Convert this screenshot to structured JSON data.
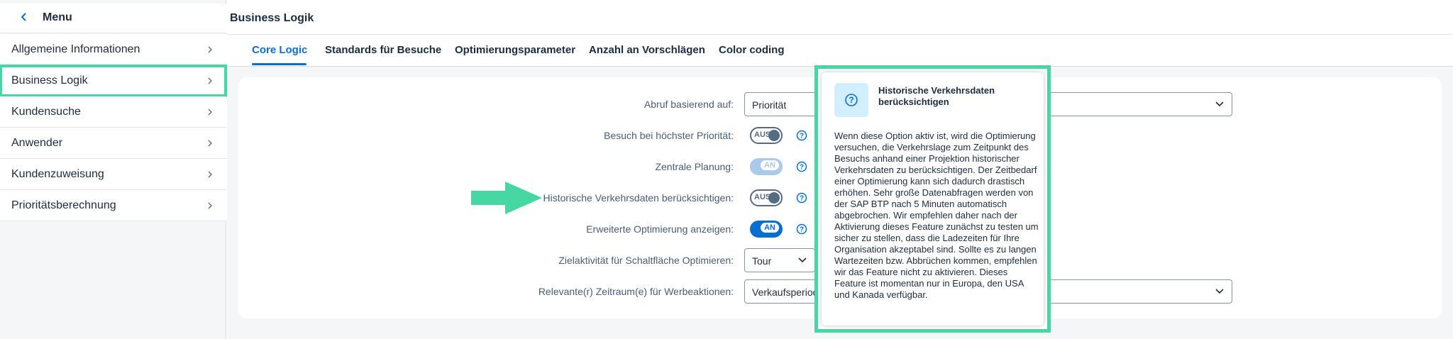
{
  "sidebar": {
    "title": "Menu",
    "items": [
      {
        "label": "Allgemeine Informationen"
      },
      {
        "label": "Business Logik"
      },
      {
        "label": "Kundensuche"
      },
      {
        "label": "Anwender"
      },
      {
        "label": "Kundenzuweisung"
      },
      {
        "label": "Prioritätsberechnung"
      }
    ],
    "selected": "Business Logik"
  },
  "header": {
    "title": "Business Logik"
  },
  "tabs": [
    {
      "label": "Core Logic",
      "active": true
    },
    {
      "label": "Standards für Besuche"
    },
    {
      "label": "Optimierungsparameter"
    },
    {
      "label": "Anzahl an Vorschlägen"
    },
    {
      "label": "Color coding"
    }
  ],
  "form": {
    "abruf": {
      "label": "Abruf basierend auf:",
      "value": "Priorität"
    },
    "besuch": {
      "label": "Besuch bei höchster Priorität:",
      "state": "AUS"
    },
    "zentrale": {
      "label": "Zentrale Planung:",
      "state": "AN"
    },
    "historische": {
      "label": "Historische Verkehrsdaten berücksichtigen:",
      "state": "AUS"
    },
    "erweiterte": {
      "label": "Erweiterte Optimierung anzeigen:",
      "state": "AN"
    },
    "zielaktivitaet": {
      "label": "Zielaktivität für Schaltfläche Optimieren:",
      "value": "Tour"
    },
    "zeitraum": {
      "label": "Relevante(r) Zeitraum(e) für Werbeaktionen:",
      "value": "Verkaufsperiode"
    }
  },
  "popover": {
    "title": "Historische Verkehrsdaten berücksichtigen",
    "body": "Wenn diese Option aktiv ist, wird die Optimierung versuchen, die Verkehrslage zum Zeitpunkt des Besuchs anhand einer Projektion historischer Verkehrsdaten zu berücksichtigen. Der Zeitbedarf einer Optimierung kann sich dadurch drastisch erhöhen. Sehr große Datenabfragen werden von der SAP BTP nach 5 Minuten automatisch abgebrochen. Wir empfehlen daher nach der Aktivierung dieses Feature zunächst zu testen um sicher zu stellen, dass die Ladezeiten für Ihre Organisation akzeptabel sind. Sollte es zu langen Wartezeiten bzw. Abbrüchen kommen, empfehlen wir das Feature nicht zu aktivieren. Dieses Feature ist momentan nur in Europa, den USA und Kanada verfügbar."
  },
  "colors": {
    "accent": "#0a6ed1",
    "highlight": "#47d7a2",
    "text": "#1d2d3e",
    "label": "#475e75"
  }
}
